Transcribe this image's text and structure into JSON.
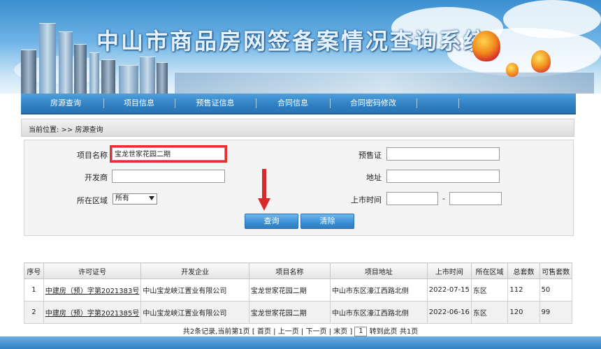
{
  "header": {
    "title": "中山市商品房网签备案情况查询系统"
  },
  "nav": {
    "items": [
      "房源查询",
      "项目信息",
      "预售证信息",
      "合同信息",
      "合同密码修改"
    ]
  },
  "breadcrumb": {
    "text": "当前位置: >> 房源查询"
  },
  "form": {
    "project_name_label": "项目名称",
    "project_name_value": "宝龙世家花园二期",
    "developer_label": "开发商",
    "developer_value": "",
    "district_label": "所在区域",
    "district_value": "所有",
    "presale_label": "预售证",
    "presale_value": "",
    "address_label": "地址",
    "address_value": "",
    "listing_time_label": "上市时间",
    "listing_from": "",
    "listing_to": "",
    "range_dash": "-",
    "search_button": "查询",
    "clear_button": "清除"
  },
  "table": {
    "headers": [
      "序号",
      "许可证号",
      "开发企业",
      "项目名称",
      "项目地址",
      "上市时间",
      "所在区域",
      "总套数",
      "可售套数"
    ],
    "rows": [
      [
        "1",
        "中建房（预）字第2021383号",
        "中山宝龙峡江置业有限公司",
        "宝龙世家花园二期",
        "中山市东区濠江西路北侧",
        "2022-07-15",
        "东区",
        "112",
        "50"
      ],
      [
        "2",
        "中建房（预）字第2021385号",
        "中山宝龙峡江置业有限公司",
        "宝龙世家花园二期",
        "中山市东区濠江西路北侧",
        "2022-06-16",
        "东区",
        "120",
        "99"
      ]
    ]
  },
  "pager": {
    "summary": "共2条记录,当前第1页 [",
    "first": "首页",
    "bar1": "|",
    "prev": "上一页",
    "bar2": "|",
    "next": "下一页",
    "bar3": "|",
    "last": "末页",
    "close": "]",
    "page_input": "1",
    "goto": "转到此页 共1页"
  },
  "colors": {
    "nav": "#2f7fc1",
    "highlight": "#e23232",
    "arrow": "#d62b2b"
  },
  "icons": [
    "hot-air-balloon-icon",
    "down-arrow-icon",
    "dropdown-arrow-icon"
  ]
}
